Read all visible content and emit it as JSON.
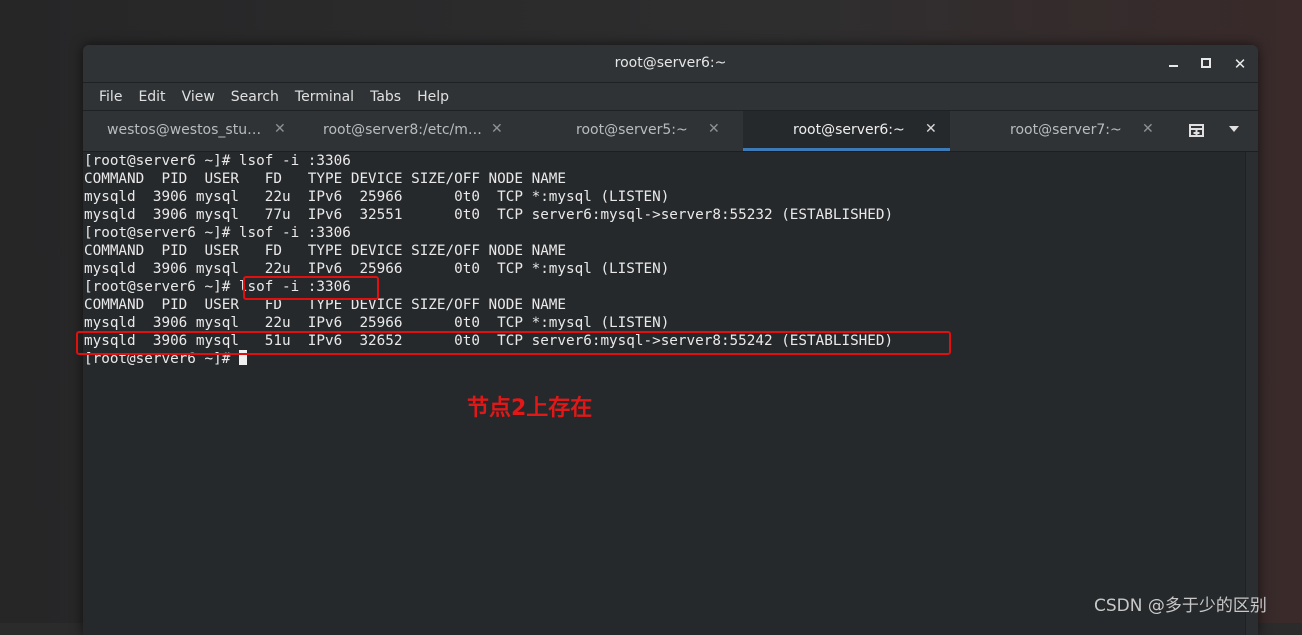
{
  "window": {
    "title": "root@server6:~"
  },
  "menubar": {
    "items": [
      "File",
      "Edit",
      "View",
      "Search",
      "Terminal",
      "Tabs",
      "Help"
    ]
  },
  "tabs": [
    {
      "label": "westos@westos_stu…",
      "active": false
    },
    {
      "label": "root@server8:/etc/m…",
      "active": false
    },
    {
      "label": "root@server5:~",
      "active": false
    },
    {
      "label": "root@server6:~",
      "active": true
    },
    {
      "label": "root@server7:~",
      "active": false
    }
  ],
  "terminal": {
    "lines": [
      "[root@server6 ~]# lsof -i :3306",
      "COMMAND  PID  USER   FD   TYPE DEVICE SIZE/OFF NODE NAME",
      "mysqld  3906 mysql   22u  IPv6  25966      0t0  TCP *:mysql (LISTEN)",
      "mysqld  3906 mysql   77u  IPv6  32551      0t0  TCP server6:mysql->server8:55232 (ESTABLISHED)",
      "[root@server6 ~]# lsof -i :3306",
      "COMMAND  PID  USER   FD   TYPE DEVICE SIZE/OFF NODE NAME",
      "mysqld  3906 mysql   22u  IPv6  25966      0t0  TCP *:mysql (LISTEN)",
      "[root@server6 ~]# lsof -i :3306",
      "COMMAND  PID  USER   FD   TYPE DEVICE SIZE/OFF NODE NAME",
      "mysqld  3906 mysql   22u  IPv6  25966      0t0  TCP *:mysql (LISTEN)",
      "mysqld  3906 mysql   51u  IPv6  32652      0t0  TCP server6:mysql->server8:55242 (ESTABLISHED)",
      "[root@server6 ~]# "
    ]
  },
  "annotation": {
    "text": "节点2上存在",
    "color": "#e01818"
  },
  "watermark": {
    "text": "CSDN @多于少的区别"
  },
  "colors": {
    "highlight": "#e01010",
    "tab_underline": "#3d7ab8",
    "terminal_bg": "#26292c"
  },
  "icons": {
    "new_tab": "new-tab-icon",
    "menu": "chevron-down-icon",
    "close": "close-icon"
  }
}
